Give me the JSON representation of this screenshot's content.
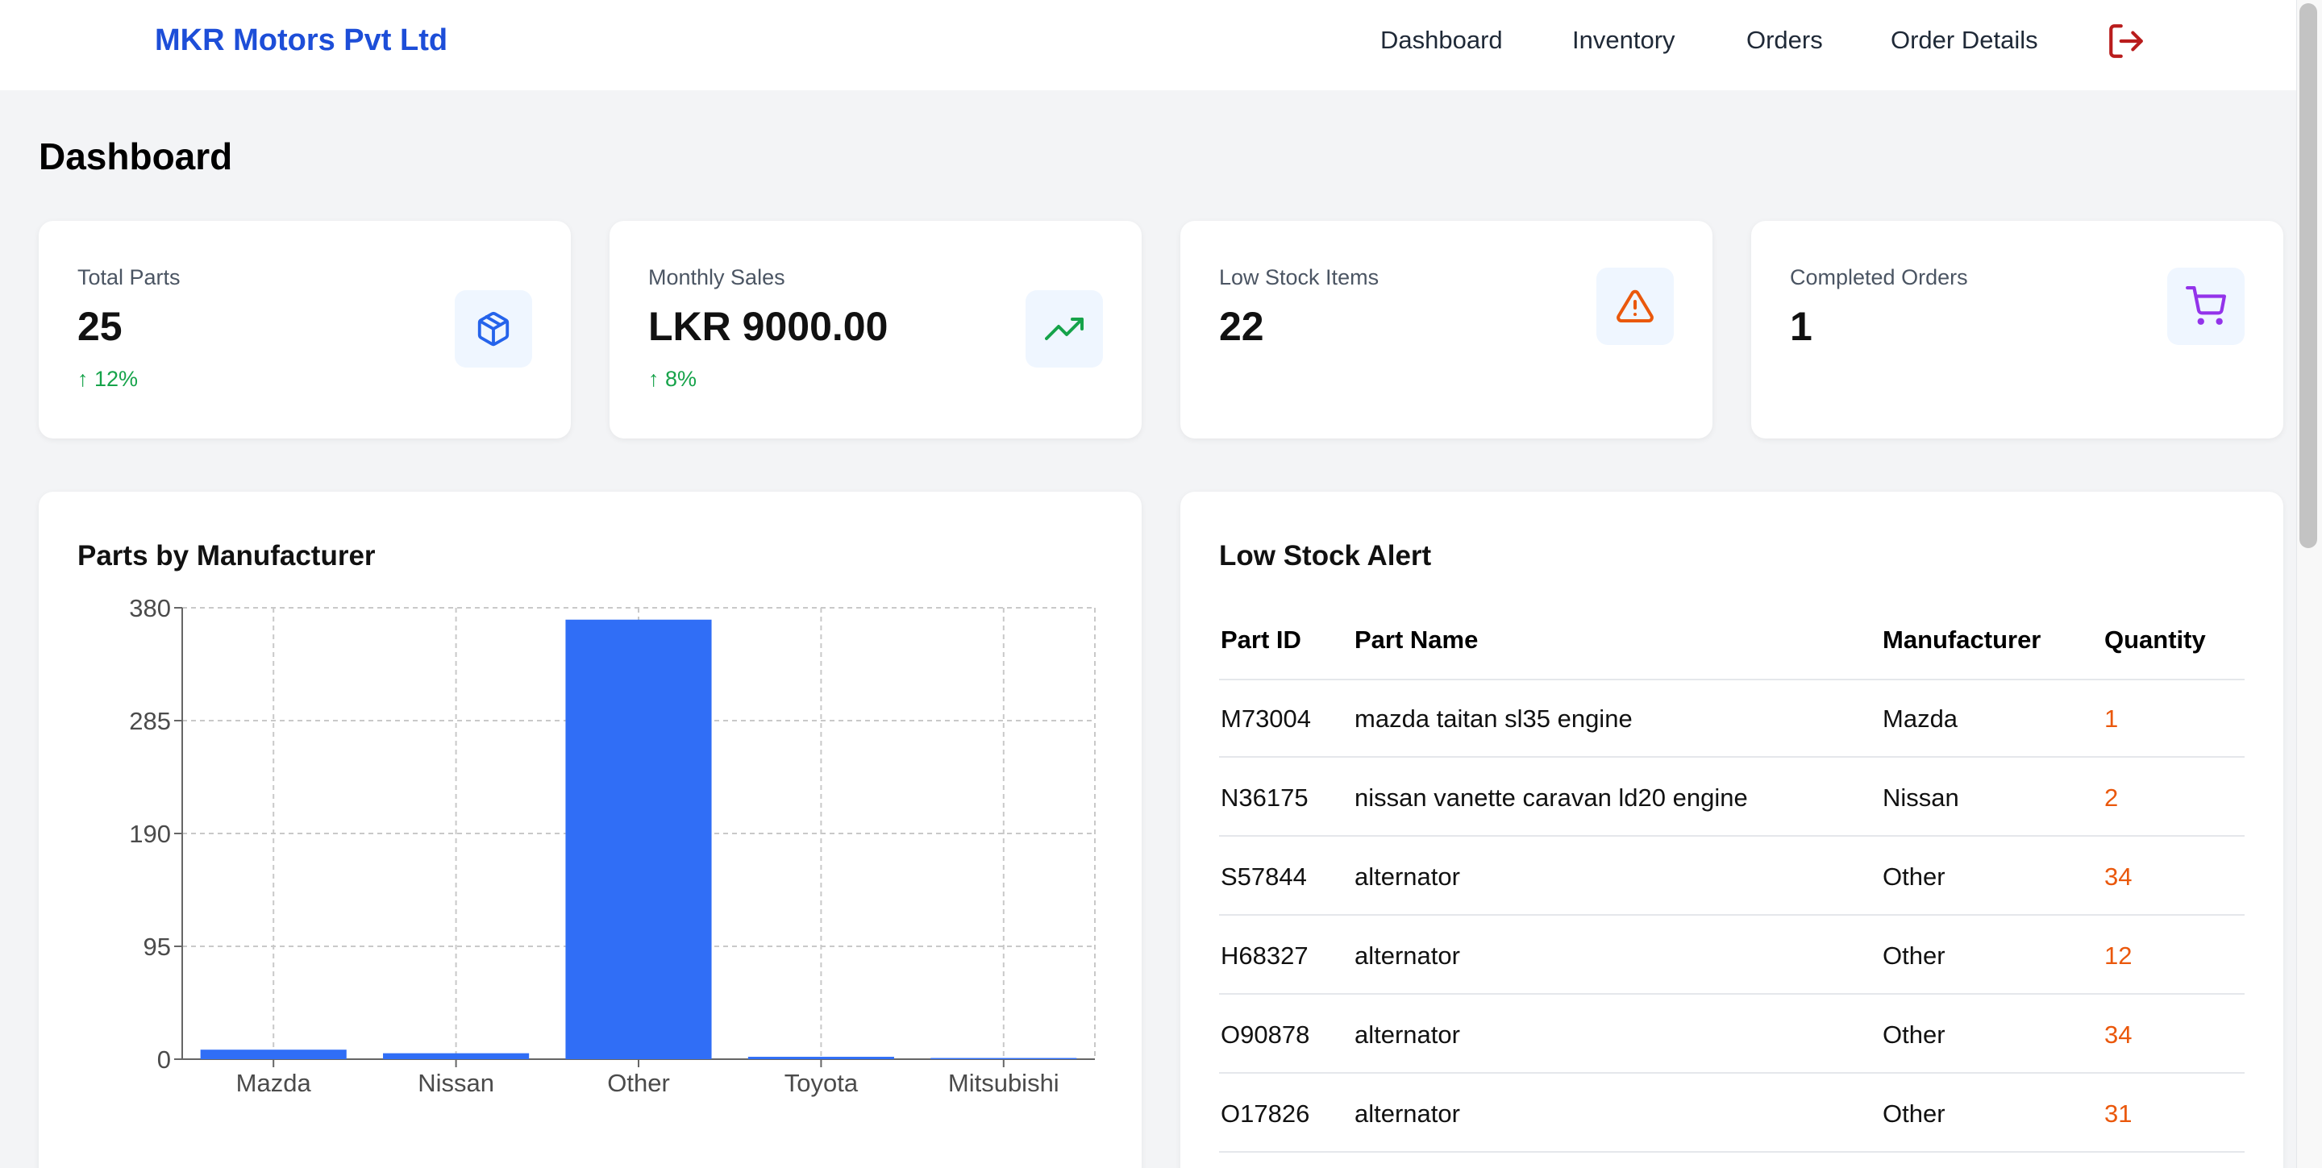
{
  "header": {
    "brand": "MKR Motors Pvt Ltd",
    "nav": [
      "Dashboard",
      "Inventory",
      "Orders",
      "Order Details"
    ],
    "logout_icon": "logout-icon"
  },
  "page_title": "Dashboard",
  "stats": [
    {
      "label": "Total Parts",
      "value": "25",
      "trend": "↑ 12%",
      "icon": "package-icon",
      "icon_color": "#2563eb"
    },
    {
      "label": "Monthly Sales",
      "value": "LKR 9000.00",
      "trend": "↑ 8%",
      "icon": "trending-up-icon",
      "icon_color": "#16a34a"
    },
    {
      "label": "Low Stock Items",
      "value": "22",
      "trend": "",
      "icon": "alert-triangle-icon",
      "icon_color": "#ea580c"
    },
    {
      "label": "Completed Orders",
      "value": "1",
      "trend": "",
      "icon": "shopping-cart-icon",
      "icon_color": "#9333ea"
    }
  ],
  "chart_panel": {
    "title": "Parts by Manufacturer"
  },
  "chart_data": {
    "type": "bar",
    "title": "Parts by Manufacturer",
    "categories": [
      "Mazda",
      "Nissan",
      "Other",
      "Toyota",
      "Mitsubishi"
    ],
    "values": [
      8,
      5,
      370,
      2,
      1
    ],
    "yticks": [
      "0",
      "95",
      "190",
      "285",
      "380"
    ],
    "ylim": [
      0,
      380
    ],
    "grid": true,
    "bar_color": "#306ef6"
  },
  "low_stock": {
    "title": "Low Stock Alert",
    "columns": [
      "Part ID",
      "Part Name",
      "Manufacturer",
      "Quantity"
    ],
    "rows": [
      [
        "M73004",
        "mazda taitan sl35 engine",
        "Mazda",
        "1"
      ],
      [
        "N36175",
        "nissan vanette caravan ld20 engine",
        "Nissan",
        "2"
      ],
      [
        "S57844",
        "alternator",
        "Other",
        "34"
      ],
      [
        "H68327",
        "alternator",
        "Other",
        "12"
      ],
      [
        "O90878",
        "alternator",
        "Other",
        "34"
      ],
      [
        "O17826",
        "alternator",
        "Other",
        "31"
      ]
    ]
  },
  "colors": {
    "brand": "#1d4ed8",
    "trend_up": "#16a34a",
    "quantity": "#ea580c",
    "logout": "#b91c1c"
  }
}
